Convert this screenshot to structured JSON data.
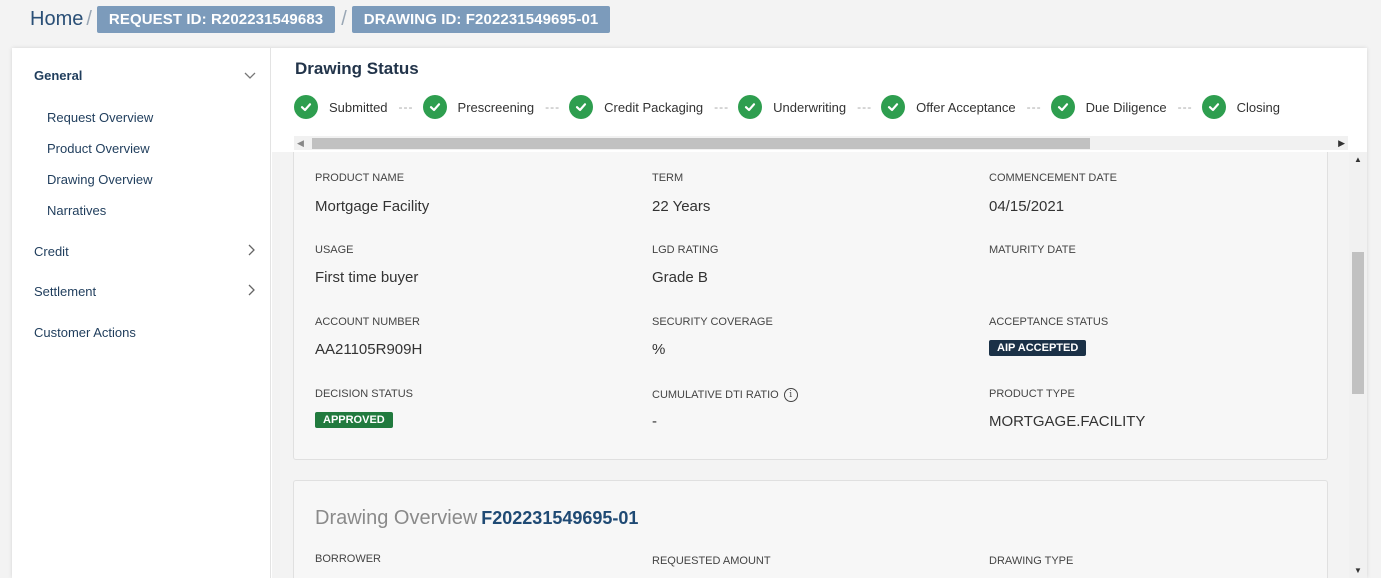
{
  "breadcrumb": {
    "home": "Home",
    "separator": "/",
    "request_id": "REQUEST ID: R202231549683",
    "drawing_id": "DRAWING ID: F202231549695-01"
  },
  "sidebar": {
    "general": "General",
    "general_items": [
      "Request Overview",
      "Product Overview",
      "Drawing Overview",
      "Narratives"
    ],
    "credit": "Credit",
    "settlement": "Settlement",
    "customer_actions": "Customer Actions"
  },
  "status": {
    "title": "Drawing Status",
    "steps": [
      "Submitted",
      "Prescreening",
      "Credit Packaging",
      "Underwriting",
      "Offer Acceptance",
      "Due Diligence",
      "Closing"
    ],
    "step_color": "#2e9e4f"
  },
  "details": {
    "product_name_label": "PRODUCT NAME",
    "product_name": "Mortgage Facility",
    "term_label": "TERM",
    "term": "22 Years",
    "commencement_label": "COMMENCEMENT DATE",
    "commencement": "04/15/2021",
    "usage_label": "USAGE",
    "usage": "First time buyer",
    "lgd_label": "LGD RATING",
    "lgd": "Grade B",
    "maturity_label": "MATURITY DATE",
    "maturity": "",
    "account_label": "ACCOUNT NUMBER",
    "account": "AA21105R909H",
    "security_label": "SECURITY COVERAGE",
    "security": "%",
    "acceptance_label": "ACCEPTANCE STATUS",
    "acceptance": "AIP ACCEPTED",
    "decision_label": "DECISION STATUS",
    "decision": "APPROVED",
    "dti_label": "CUMULATIVE DTI RATIO",
    "dti": "-",
    "product_type_label": "PRODUCT TYPE",
    "product_type": "MORTGAGE.FACILITY"
  },
  "overview": {
    "title": "Drawing Overview",
    "id": "F202231549695-01",
    "borrower_label": "BORROWER",
    "requested_label": "REQUESTED AMOUNT",
    "drawing_type_label": "DRAWING TYPE"
  }
}
